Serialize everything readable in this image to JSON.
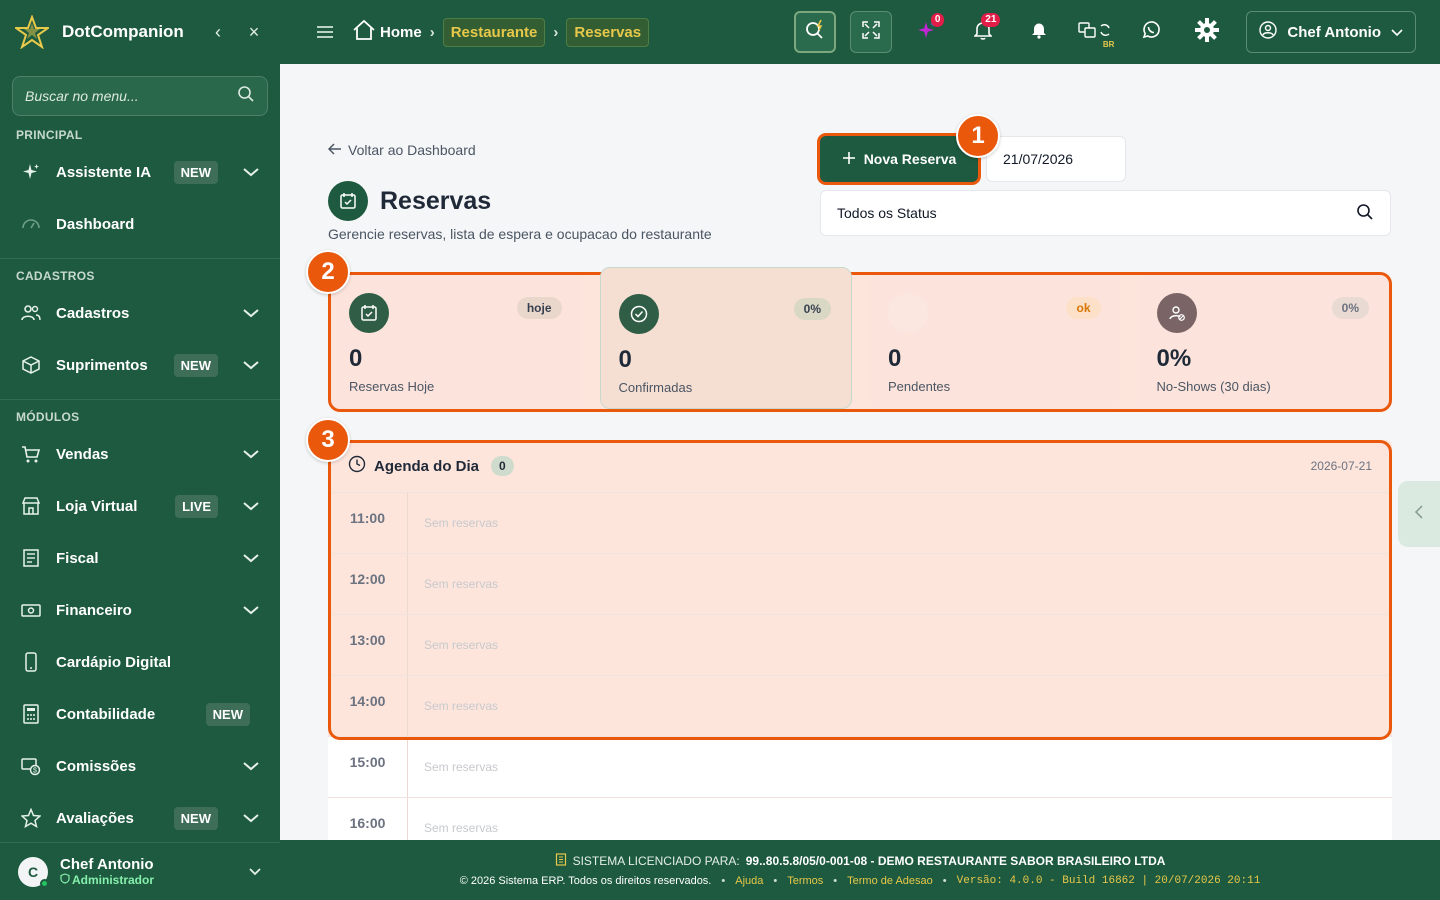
{
  "brand": {
    "name": "DotCompanion"
  },
  "sidebar": {
    "search_placeholder": "Buscar no menu...",
    "sections": {
      "principal": "PRINCIPAL",
      "cadastros": "CADASTROS",
      "modulos": "MÓDULOS"
    },
    "items": [
      {
        "label": "Assistente IA",
        "badge": "NEW"
      },
      {
        "label": "Dashboard"
      },
      {
        "label": "Cadastros"
      },
      {
        "label": "Suprimentos",
        "badge": "NEW"
      },
      {
        "label": "Vendas"
      },
      {
        "label": "Loja Virtual",
        "badge": "LIVE"
      },
      {
        "label": "Fiscal"
      },
      {
        "label": "Financeiro"
      },
      {
        "label": "Cardápio Digital"
      },
      {
        "label": "Contabilidade",
        "badge": "NEW"
      },
      {
        "label": "Comissões"
      },
      {
        "label": "Avaliações",
        "badge": "NEW"
      }
    ],
    "user": {
      "initial": "C",
      "name": "Chef Antonio",
      "role": "Administrador"
    }
  },
  "topbar": {
    "crumbs": {
      "home": "Home",
      "c1": "Restaurante",
      "c2": "Reservas"
    },
    "badges": {
      "ai": "0",
      "notifications": "21"
    },
    "lang_label": "BR",
    "user_name": "Chef Antonio"
  },
  "page": {
    "back_label": "Voltar ao Dashboard",
    "title": "Reservas",
    "subtitle": "Gerencie reservas, lista de espera e ocupacao do restaurante",
    "new_button": "Nova Reserva",
    "date_value": "21/07/2026",
    "status_filter": "Todos os Status"
  },
  "markers": [
    "1",
    "2",
    "3"
  ],
  "stats": [
    {
      "value": "0",
      "label": "Reservas Hoje",
      "pill": "hoje"
    },
    {
      "value": "0",
      "label": "Confirmadas",
      "pill": "0%"
    },
    {
      "value": "0",
      "label": "Pendentes",
      "pill": "ok"
    },
    {
      "value": "0%",
      "label": "No-Shows (30 dias)",
      "pill": "0%"
    }
  ],
  "agenda": {
    "title": "Agenda do Dia",
    "count": "0",
    "date": "2026-07-21",
    "empty_label": "Sem reservas",
    "slots": [
      "11:00",
      "12:00",
      "13:00",
      "14:00",
      "15:00",
      "16:00"
    ]
  },
  "footer": {
    "license_prefix": "SISTEMA LICENCIADO PARA:",
    "license_value": "99..80.5.8/05/0-001-08 - DEMO RESTAURANTE SABOR BRASILEIRO LTDA",
    "copyright": "© 2026 Sistema ERP. Todos os direitos reservados.",
    "links": {
      "help": "Ajuda",
      "terms": "Termos",
      "adhesion": "Termo de Adesao"
    },
    "version": "Versão: 4.0.0 - Build 16862 | 20/07/2026 20:11"
  },
  "colors": {
    "primary": "#1d5a3f",
    "accent": "#e7c84a",
    "highlight": "#ea580c",
    "highlight_fill": "#fde5dc"
  }
}
